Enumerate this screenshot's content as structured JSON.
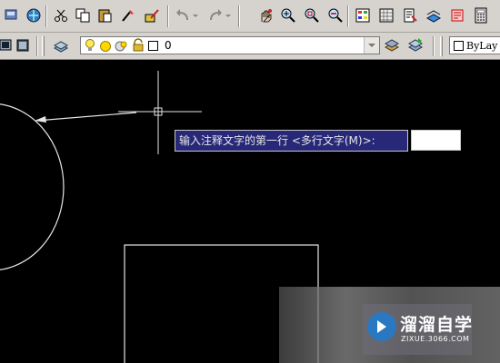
{
  "toolbar": {
    "standard_icons": [
      "publish-icon",
      "plot-icon",
      "cut-icon",
      "copy-icon",
      "paste-icon",
      "match-properties-icon",
      "block-editor-icon",
      "undo-icon",
      "redo-icon",
      "pan-icon",
      "zoom-realtime-icon",
      "zoom-window-icon",
      "zoom-previous-icon",
      "properties-icon",
      "design-center-icon",
      "tool-palettes-icon",
      "sheet-set-icon",
      "markup-icon",
      "calculator-icon"
    ]
  },
  "layers": {
    "current_layer": "0",
    "state_icons": [
      "layer-on-icon",
      "freeze-sun-icon",
      "lock-icon",
      "color-swatch-icon"
    ]
  },
  "properties": {
    "color_value": "ByLay"
  },
  "command": {
    "prompt_text": "输入注释文字的第一行 <多行文字(M)>:",
    "input_value": ""
  },
  "watermark": {
    "title": "溜溜自学",
    "url": "ZIXUE.3066.COM"
  },
  "colors": {
    "canvas": "#000000",
    "prompt_bg": "#282878",
    "toolbar_bg": "#d6d3ce",
    "logo": "#2b78c2"
  }
}
